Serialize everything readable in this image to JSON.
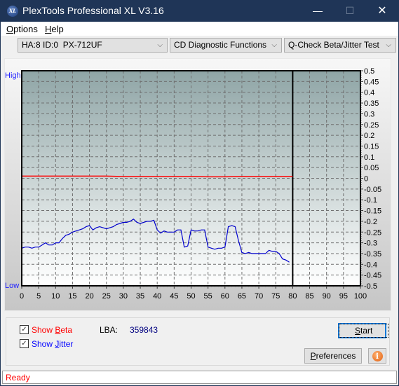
{
  "window": {
    "title": "PlexTools Professional XL V3.16",
    "icon": "xl-app-icon",
    "icon_text": "XL",
    "controls": {
      "minimize": "—",
      "maximize": "☐",
      "close": "✕"
    }
  },
  "menu": {
    "items": [
      {
        "label": "Options",
        "accel": "O"
      },
      {
        "label": "Help",
        "accel": "H"
      }
    ]
  },
  "toolbar": {
    "drive_select": "HA:8 ID:0  PX-712UF",
    "function_select": "CD Diagnostic Functions",
    "test_select": "Q-Check Beta/Jitter Test",
    "chevron": "⌵"
  },
  "chart_data": {
    "type": "line",
    "title": "",
    "left_axis_labels": {
      "top": "High",
      "bottom": "Low"
    },
    "xlabel": "",
    "ylabel": "",
    "xlim": [
      0,
      100
    ],
    "ylim": [
      -0.5,
      0.5
    ],
    "x_ticks": [
      0,
      5,
      10,
      15,
      20,
      25,
      30,
      35,
      40,
      45,
      50,
      55,
      60,
      65,
      70,
      75,
      80,
      85,
      90,
      95,
      100
    ],
    "y_ticks": [
      0.5,
      0.45,
      0.4,
      0.35,
      0.3,
      0.25,
      0.2,
      0.15,
      0.1,
      0.05,
      0,
      -0.05,
      -0.1,
      -0.15,
      -0.2,
      -0.25,
      -0.3,
      -0.35,
      -0.4,
      -0.45,
      -0.5
    ],
    "y_tick_labels": [
      "0.5",
      "0.45",
      "0.4",
      "0.35",
      "0.3",
      "0.25",
      "0.2",
      "0.15",
      "0.1",
      "0.05",
      "0",
      "-0.05",
      "-0.1",
      "-0.15",
      "-0.2",
      "-0.25",
      "-0.3",
      "-0.35",
      "-0.4",
      "-0.45",
      "-0.5"
    ],
    "grid": true,
    "end_marker_x": 80,
    "series": [
      {
        "name": "Beta",
        "color": "#ff0000",
        "x": [
          0,
          5,
          10,
          15,
          20,
          25,
          30,
          35,
          40,
          45,
          50,
          55,
          60,
          65,
          70,
          75,
          80
        ],
        "values": [
          0.01,
          0.01,
          0.01,
          0.01,
          0.01,
          0.01,
          0.008,
          0.008,
          0.008,
          0.008,
          0.008,
          0.007,
          0.007,
          0.008,
          0.008,
          0.008,
          0.008
        ]
      },
      {
        "name": "Jitter",
        "color": "#0000cc",
        "x": [
          0,
          1,
          2,
          3,
          4,
          5,
          6,
          7,
          8,
          9,
          10,
          11,
          12,
          13,
          14,
          15,
          16,
          17,
          18,
          19,
          20,
          21,
          22,
          23,
          24,
          25,
          26,
          27,
          28,
          29,
          30,
          31,
          32,
          33,
          34,
          35,
          36,
          37,
          38,
          39,
          40,
          41,
          42,
          43,
          44,
          45,
          46,
          47,
          48,
          49,
          50,
          51,
          52,
          53,
          54,
          55,
          56,
          57,
          58,
          59,
          60,
          61,
          62,
          63,
          64,
          65,
          66,
          67,
          68,
          69,
          70,
          71,
          72,
          73,
          74,
          75,
          76,
          77,
          78,
          79
        ],
        "values": [
          -0.325,
          -0.32,
          -0.32,
          -0.325,
          -0.32,
          -0.32,
          -0.31,
          -0.3,
          -0.31,
          -0.31,
          -0.3,
          -0.3,
          -0.28,
          -0.265,
          -0.26,
          -0.25,
          -0.245,
          -0.24,
          -0.235,
          -0.225,
          -0.22,
          -0.24,
          -0.23,
          -0.225,
          -0.23,
          -0.235,
          -0.23,
          -0.225,
          -0.215,
          -0.21,
          -0.205,
          -0.205,
          -0.2,
          -0.19,
          -0.205,
          -0.21,
          -0.205,
          -0.2,
          -0.2,
          -0.195,
          -0.24,
          -0.255,
          -0.245,
          -0.25,
          -0.25,
          -0.25,
          -0.24,
          -0.24,
          -0.32,
          -0.315,
          -0.24,
          -0.245,
          -0.245,
          -0.24,
          -0.24,
          -0.32,
          -0.325,
          -0.33,
          -0.325,
          -0.325,
          -0.32,
          -0.225,
          -0.22,
          -0.225,
          -0.29,
          -0.345,
          -0.35,
          -0.345,
          -0.35,
          -0.35,
          -0.35,
          -0.35,
          -0.35,
          -0.335,
          -0.34,
          -0.34,
          -0.35,
          -0.375,
          -0.38,
          -0.39
        ]
      }
    ]
  },
  "controls": {
    "show_beta": {
      "label_pre": "Show ",
      "accel": "B",
      "label_post": "eta",
      "checked": true,
      "color": "#ff0000"
    },
    "show_jitter": {
      "label_pre": "Show ",
      "accel": "J",
      "label_post": "itter",
      "checked": true,
      "color": "#0000ff"
    },
    "lba_label": "LBA:",
    "lba_value": "359843",
    "start_button": {
      "accel": "S",
      "rest": "tart"
    },
    "preferences_button": {
      "accel": "P",
      "rest": "references"
    },
    "info_button_icon": "i"
  },
  "status": {
    "text": "Ready",
    "color": "#ff0000"
  }
}
